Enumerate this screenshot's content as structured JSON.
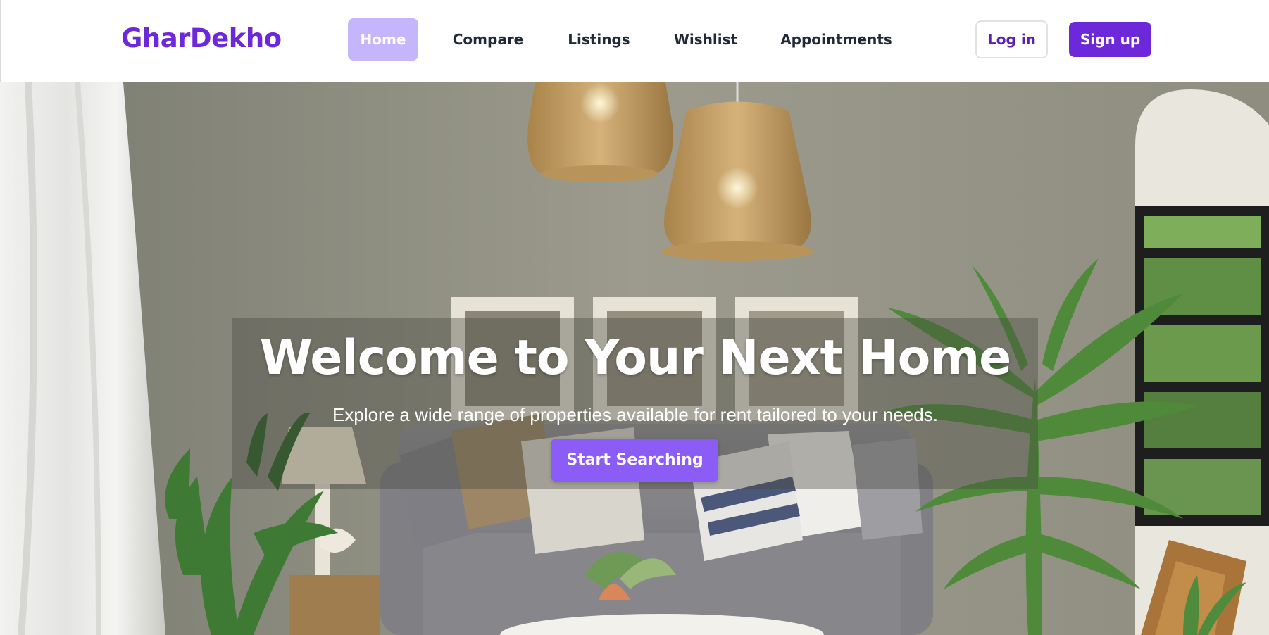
{
  "brand": {
    "name": "GharDekho",
    "color": "#6d28d9"
  },
  "nav": {
    "items": [
      {
        "label": "Home",
        "active": true
      },
      {
        "label": "Compare",
        "active": false
      },
      {
        "label": "Listings",
        "active": false
      },
      {
        "label": "Wishlist",
        "active": false
      },
      {
        "label": "Appointments",
        "active": false
      }
    ],
    "active_color": "#c4b5fd"
  },
  "auth": {
    "login_label": "Log in",
    "signup_label": "Sign up"
  },
  "hero": {
    "title": "Welcome to Your Next Home",
    "subtitle": "Explore a wide range of properties available for rent tailored to your needs.",
    "cta_label": "Start Searching",
    "cta_color": "#8b5cf6",
    "background_image": "living-room-photo"
  }
}
